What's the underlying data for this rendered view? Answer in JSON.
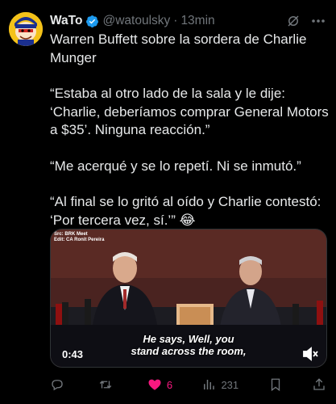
{
  "tweet": {
    "author_name": "WaTo",
    "handle": "@watoulsky",
    "separator": "·",
    "time": "13min",
    "paragraphs": [
      "Warren Buffett sobre la sordera de Charlie Munger",
      "“Estaba al otro lado de la sala y le dije: ‘Charlie, deberíamos comprar General Motors a $35’. Ninguna reacción.”",
      "“Me acerqué y se lo repetí. Ni se inmutó.”",
      "“Al final se lo gritó al oído y Charlie contestó: ‘Por tercera vez, sí.’” 😂"
    ]
  },
  "video": {
    "credit_line1": "Src: BRK Meet",
    "credit_line2": "Edit: CA Ronit Pereira",
    "subtitle_line1": "He says, Well, you",
    "subtitle_line2": "stand across the room,",
    "duration": "0:43"
  },
  "actions": {
    "replies": "",
    "reposts": "",
    "likes": "6",
    "views": "231"
  },
  "colors": {
    "accent_like": "#f91880",
    "verified": "#1d9bf0",
    "muted_text": "#71767b"
  },
  "icons": [
    "verified-badge-icon",
    "grok-icon",
    "more-icon",
    "mute-icon",
    "reply-icon",
    "repost-icon",
    "heart-icon",
    "views-icon",
    "bookmark-icon",
    "share-icon"
  ]
}
